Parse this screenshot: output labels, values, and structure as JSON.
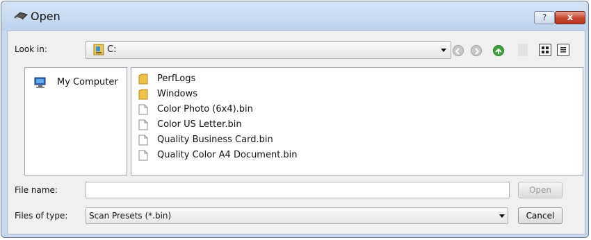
{
  "window": {
    "title": "Open",
    "help_glyph": "?",
    "close_glyph": "x"
  },
  "toolbar": {
    "look_in_label": "Look in:",
    "look_in_value": "C:",
    "icons": [
      "back-icon",
      "forward-icon",
      "up-folder-icon",
      "thumbnail-view-icon",
      "list-view-icon"
    ]
  },
  "places": {
    "items": [
      {
        "label": "My Computer",
        "icon": "my-computer-icon"
      }
    ]
  },
  "files": {
    "items": [
      {
        "name": "PerfLogs",
        "type": "folder"
      },
      {
        "name": "Windows",
        "type": "folder"
      },
      {
        "name": "Color Photo (6x4).bin",
        "type": "file"
      },
      {
        "name": "Color US Letter.bin",
        "type": "file"
      },
      {
        "name": "Quality Business Card.bin",
        "type": "file"
      },
      {
        "name": "Quality Color A4 Document.bin",
        "type": "file"
      }
    ]
  },
  "footer": {
    "file_name_label": "File name:",
    "file_name_value": "",
    "files_of_type_label": "Files of type:",
    "files_of_type_value": "Scan Presets (*.bin)",
    "open_label": "Open",
    "cancel_label": "Cancel"
  },
  "colors": {
    "folder": "#f0c24a",
    "close_button": "#c8442c",
    "up_arrow": "#3aa33a"
  }
}
